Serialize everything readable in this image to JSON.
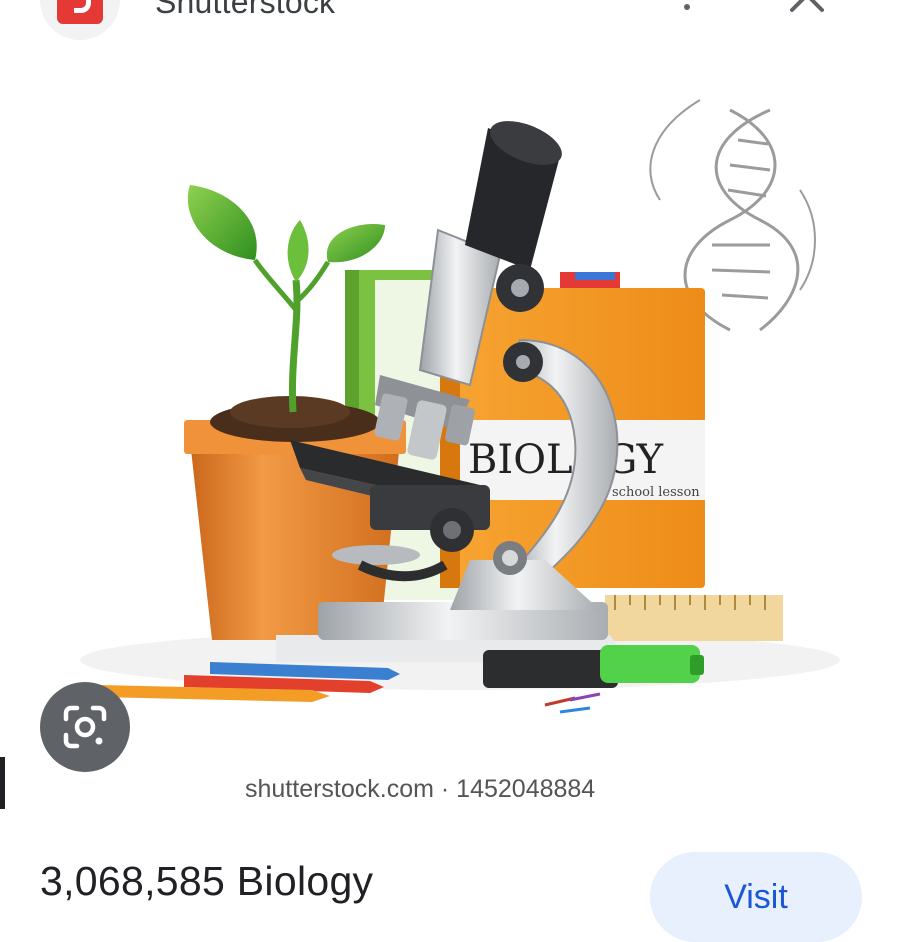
{
  "header": {
    "site_name": "Shutterstock",
    "favicon_icon": "shutterstock-logo-icon",
    "more_icon": "more-vert-icon",
    "close_icon": "close-icon"
  },
  "image": {
    "book_title": "BIOLOGY",
    "book_subtitle": "school lesson",
    "caption": "shutterstock.com · 1452048884",
    "lens_icon": "google-lens-icon"
  },
  "result": {
    "title": "3,068,585 Biology",
    "visit_label": "Visit"
  },
  "colors": {
    "accent_blue": "#1a56d6",
    "visit_bg": "#e8f0fe",
    "favicon_red": "#e53935",
    "book_orange": "#f59a23",
    "pot_orange": "#e8822a"
  }
}
